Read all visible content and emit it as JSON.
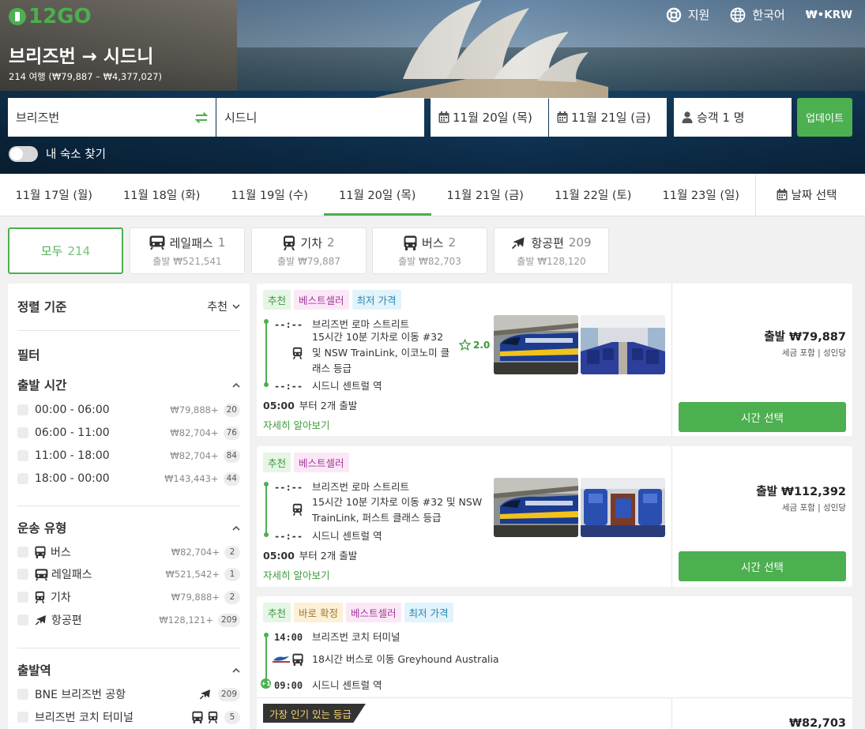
{
  "header": {
    "logo": "12GO",
    "nav": [
      {
        "icon": "lifebuoy-icon",
        "label": "지원"
      },
      {
        "icon": "globe-icon",
        "label": "한국어"
      },
      {
        "icon": "currency-icon",
        "label": "₩•KRW"
      }
    ],
    "title": "브리즈번 → 시드니",
    "subtitle": "214 여행 (₩79,887 – ₩4,377,027)"
  },
  "search": {
    "from": "브리즈번",
    "to": "시드니",
    "date_out": "11월 20일 (목)",
    "date_back": "11월 21일 (금)",
    "passengers": "승객 1 명",
    "update": "업데이트",
    "toggle_label": "내 숙소 찾기"
  },
  "dates": {
    "items": [
      "11월 17일 (월)",
      "11월 18일 (화)",
      "11월 19일 (수)",
      "11월 20일 (목)",
      "11월 21일 (금)",
      "11월 22일 (토)",
      "11월 23일 (일)"
    ],
    "active": 3,
    "pick": "날짜 선택"
  },
  "modes": [
    {
      "label": "모두",
      "count": "214",
      "from": ""
    },
    {
      "label": "레일패스",
      "count": "1",
      "from": "출발 ₩521,541"
    },
    {
      "label": "기차",
      "count": "2",
      "from": "출발 ₩79,887"
    },
    {
      "label": "버스",
      "count": "2",
      "from": "출발 ₩82,703"
    },
    {
      "label": "항공편",
      "count": "209",
      "from": "출발 ₩128,120"
    }
  ],
  "sidebar": {
    "sort_label": "정렬 기준",
    "sort_value": "추천",
    "filter_label": "필터",
    "departure_time": {
      "title": "출발 시간",
      "items": [
        {
          "label": "00:00 - 06:00",
          "price": "₩79,888+",
          "count": "20"
        },
        {
          "label": "06:00 - 11:00",
          "price": "₩82,704+",
          "count": "76"
        },
        {
          "label": "11:00 - 18:00",
          "price": "₩82,704+",
          "count": "84"
        },
        {
          "label": "18:00 - 00:00",
          "price": "₩143,443+",
          "count": "44"
        }
      ]
    },
    "transport_type": {
      "title": "운송 유형",
      "items": [
        {
          "label": "버스",
          "price": "₩82,704+",
          "count": "2"
        },
        {
          "label": "레일패스",
          "price": "₩521,542+",
          "count": "1"
        },
        {
          "label": "기차",
          "price": "₩79,888+",
          "count": "2"
        },
        {
          "label": "항공편",
          "price": "₩128,121+",
          "count": "209"
        }
      ]
    },
    "departure_station": {
      "title": "출발역",
      "items": [
        {
          "label": "BNE 브리즈번 공항",
          "count": "209"
        },
        {
          "label": "브리즈번 코치 터미널",
          "count": "5"
        }
      ]
    }
  },
  "results": [
    {
      "tags": [
        "추천",
        "베스트셀러",
        "최저 가격"
      ],
      "dep_time": "--:--",
      "dep_station": "브리즈번 로마 스트리트",
      "segment_lines": [
        "15시간 10분 기차로 이동 #32",
        "및 NSW TrainLink, 이코노미 클",
        "래스 등급"
      ],
      "rating": "2.0",
      "arr_time": "--:--",
      "arr_station": "시드니 센트럴 역",
      "departures_time": "05:00",
      "departures_text": "부터 2개 출발",
      "more": "자세히 알아보기",
      "price": "출발 ₩79,887",
      "price_note": "세금 포함 | 성인당",
      "select": "시간 선택"
    },
    {
      "tags": [
        "추천",
        "베스트셀러"
      ],
      "dep_time": "--:--",
      "dep_station": "브리즈번 로마 스트리트",
      "segment_lines": [
        "15시간 10분 기차로 이동 #32 및 NSW",
        "TrainLink, 퍼스트 클래스 등급"
      ],
      "arr_time": "--:--",
      "arr_station": "시드니 센트럴 역",
      "departures_time": "05:00",
      "departures_text": "부터 2개 출발",
      "more": "자세히 알아보기",
      "price": "출발 ₩112,392",
      "price_note": "세금 포함 | 성인당",
      "select": "시간 선택"
    },
    {
      "tags": [
        "추천",
        "바로 확정",
        "베스트셀러",
        "최저 가격"
      ],
      "dep_time": "14:00",
      "dep_station": "브리즈번 코치 터미널",
      "segment_lines": [
        "18시간 버스로 이동 Greyhound Australia"
      ],
      "arr_badge": "+1",
      "arr_time": "09:00",
      "arr_station": "시드니 센트럴 역",
      "popular": "가장 인기 있는 등급",
      "price": "₩82,703"
    }
  ],
  "colors": {
    "accent": "#4caf50"
  }
}
